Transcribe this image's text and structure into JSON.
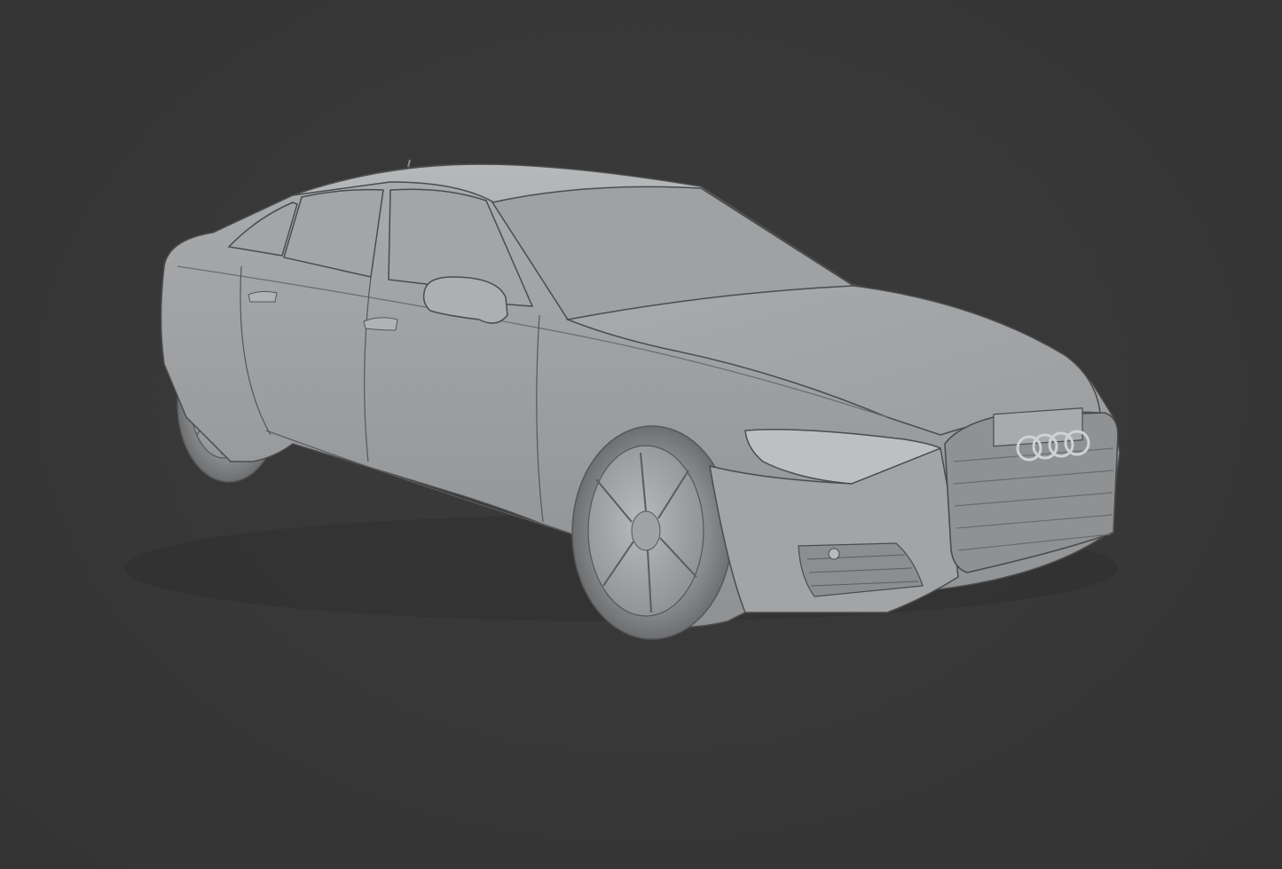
{
  "viewport": {
    "background_color": "#383838",
    "model_color": "#a6a8aa",
    "edge_color": "#4a4c4e",
    "shading": "solid",
    "object": "car-model"
  }
}
